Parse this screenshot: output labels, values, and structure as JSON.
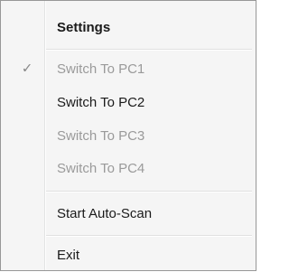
{
  "menu": {
    "header": "Settings",
    "items": [
      {
        "label": "Switch To PC1",
        "checked": true,
        "enabled": false
      },
      {
        "label": "Switch To PC2",
        "checked": false,
        "enabled": true
      },
      {
        "label": "Switch To PC3",
        "checked": false,
        "enabled": false
      },
      {
        "label": "Switch To PC4",
        "checked": false,
        "enabled": false
      }
    ],
    "auto_scan": "Start Auto-Scan",
    "exit": "Exit",
    "check_glyph": "✓"
  }
}
